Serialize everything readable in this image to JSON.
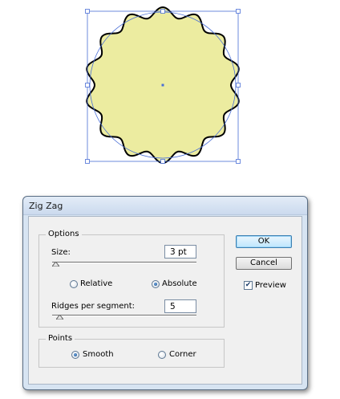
{
  "canvas": {
    "shape_fill": "#ececa0",
    "outline_color": "#000000",
    "selection_color": "#4a6fd6"
  },
  "dialog": {
    "title": "Zig Zag",
    "options_group": {
      "legend": "Options",
      "size": {
        "label": "Size:",
        "value": "3 pt",
        "slider_position": 0.0
      },
      "mode": {
        "relative_label": "Relative",
        "absolute_label": "Absolute",
        "selected": "Absolute"
      },
      "ridges": {
        "label": "Ridges per segment:",
        "value": "5",
        "slider_position": 0.05
      }
    },
    "points_group": {
      "legend": "Points",
      "smooth_label": "Smooth",
      "corner_label": "Corner",
      "selected": "Smooth"
    },
    "buttons": {
      "ok": "OK",
      "cancel": "Cancel"
    },
    "preview": {
      "label": "Preview",
      "checked": true
    }
  }
}
